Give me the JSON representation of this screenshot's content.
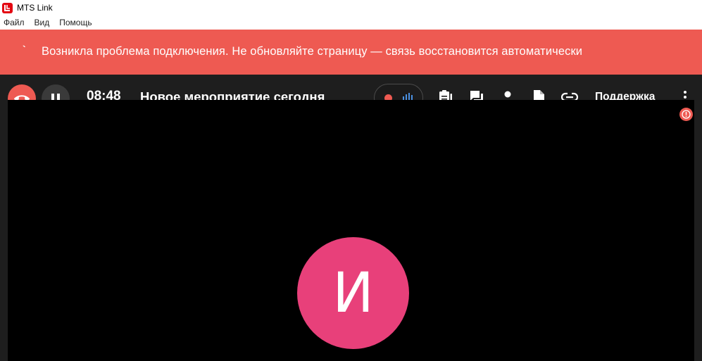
{
  "window": {
    "title": "MTS Link",
    "logo_icon": "mts-link-logo-icon",
    "logo_color": "#e30611"
  },
  "menu": {
    "items": [
      "Файл",
      "Вид",
      "Помощь"
    ]
  },
  "banner": {
    "icon": "`",
    "text": "Возникла проблема подключения. Не обновляйте страницу — связь восстановится автоматически",
    "color": "#ee5a52"
  },
  "toolbar": {
    "background": "#1e1e1e",
    "hangup_icon": "phone-hangup-icon",
    "hangup_color": "#ee5a52",
    "pause_icon": "pause-icon",
    "timer": "08:48",
    "event_title": "Новое мероприятие сегодня",
    "record_dot_color": "#ee5a52",
    "audio_wave_color": "#4a90e2",
    "tools": [
      {
        "name": "notes-icon"
      },
      {
        "name": "chat-icon"
      },
      {
        "name": "participants-icon"
      },
      {
        "name": "document-icon"
      },
      {
        "name": "link-icon"
      }
    ],
    "support_label": "Поддержка",
    "more_icon": "more-vertical-icon",
    "alert_icon": "alert-icon",
    "alert_color": "#ee5a52"
  },
  "stage": {
    "avatar_letter": "И",
    "avatar_color": "#e8407a"
  }
}
